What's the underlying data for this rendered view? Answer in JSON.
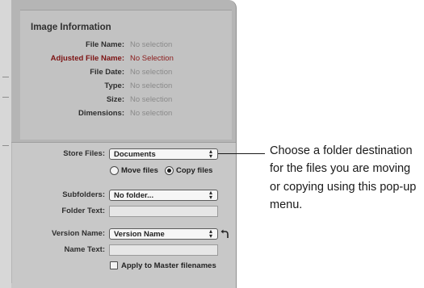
{
  "image_information": {
    "title": "Image Information",
    "rows": [
      {
        "label": "File Name:",
        "value": "No selection"
      },
      {
        "label": "Adjusted File Name:",
        "value": "No Selection"
      },
      {
        "label": "File Date:",
        "value": "No selection"
      },
      {
        "label": "Type:",
        "value": "No selection"
      },
      {
        "label": "Size:",
        "value": "No selection"
      },
      {
        "label": "Dimensions:",
        "value": "No selection"
      }
    ]
  },
  "settings": {
    "store_files": {
      "label": "Store Files:",
      "value": "Documents"
    },
    "move_files": {
      "label": "Move files",
      "selected": false
    },
    "copy_files": {
      "label": "Copy files",
      "selected": true
    },
    "subfolders": {
      "label": "Subfolders:",
      "value": "No folder..."
    },
    "folder_text": {
      "label": "Folder Text:",
      "value": ""
    },
    "version_name": {
      "label": "Version Name:",
      "value": "Version Name"
    },
    "name_text": {
      "label": "Name Text:",
      "value": ""
    },
    "apply_master": {
      "label": "Apply to Master filenames",
      "checked": false
    }
  },
  "callout": {
    "text": "Choose a folder destination for the files you are moving or copying using this pop-up menu."
  },
  "icons": {
    "popup_arrows": "updown-chevron-icon",
    "revert": "revert-arrow-icon"
  },
  "colors": {
    "adjusted_label": "#7d1313",
    "panel_background": "#c2c2c2"
  }
}
